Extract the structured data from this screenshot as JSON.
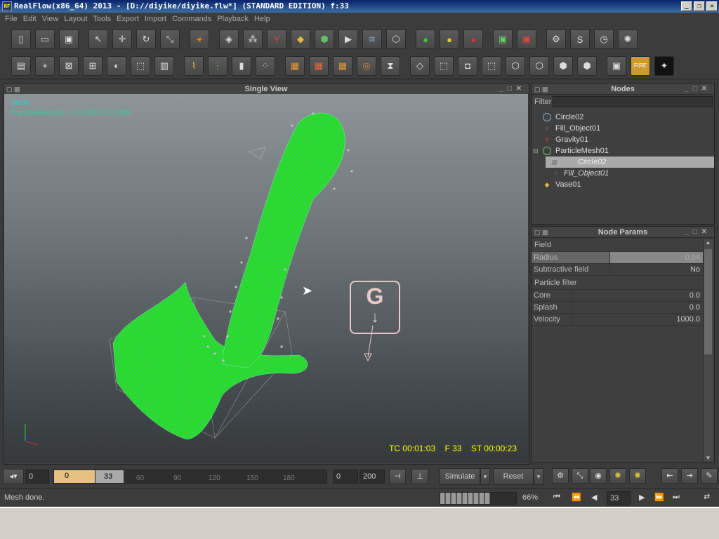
{
  "window": {
    "title": "RealFlow(x86_64) 2013 - [D://diyike/diyike.flw*] (STANDARD EDITION) f:33",
    "icon_text": "RF",
    "minimize": "_",
    "restore": "❐",
    "close": "✕"
  },
  "menu": [
    "File",
    "Edit",
    "View",
    "Layout",
    "Tools",
    "Export",
    "Import",
    "Commands",
    "Playback",
    "Help"
  ],
  "viewport": {
    "title": "Single View",
    "camera": "persp",
    "mesh_info": "ParticleMesh01 - V:3,092 F:17,008",
    "gravity_letter": "G",
    "hud_tc": "TC 00:01:03",
    "hud_f": "F 33",
    "hud_st": "ST 00:00:23"
  },
  "nodes": {
    "title": "Nodes",
    "filter_label": "Filter",
    "items": [
      {
        "label": "Circle02",
        "icon": "circle-emitter-icon",
        "indent": 0
      },
      {
        "label": "Fill_Object01",
        "icon": "fill-object-icon",
        "indent": 0
      },
      {
        "label": "Gravity01",
        "icon": "gravity-icon",
        "indent": 0
      },
      {
        "label": "ParticleMesh01",
        "icon": "particle-mesh-icon",
        "indent": 0
      },
      {
        "label": "Circle02",
        "icon": "circle-emitter-icon",
        "indent": 1,
        "selected": true
      },
      {
        "label": "Fill_Object01",
        "icon": "fill-object-icon",
        "indent": 1
      },
      {
        "label": "Vase01",
        "icon": "vase-object-icon",
        "indent": 0
      }
    ]
  },
  "params": {
    "title": "Node Params",
    "section_field": "Field",
    "radius_label": "Radius",
    "radius_value": "0.04",
    "subtractive_label": "Subtractive field",
    "subtractive_value": "No",
    "section_filter": "Particle filter",
    "core_label": "Core",
    "core_value": "0.0",
    "splash_label": "Splash",
    "splash_value": "0.0",
    "velocity_label": "Velocity",
    "velocity_value": "1000.0"
  },
  "timeline": {
    "start": "0",
    "frame_marker": "0",
    "current": "33",
    "ticks": [
      "60",
      "90",
      "120",
      "150",
      "180"
    ],
    "range_start": "0",
    "range_end": "200",
    "simulate_label": "Simulate",
    "reset_label": "Reset"
  },
  "status": {
    "message": "Mesh done.",
    "progress_percent": 66,
    "progress_label": "66%",
    "frame_field": "33"
  },
  "colors": {
    "mesh_green": "#22dd22",
    "hud_yellow": "#ffff00",
    "camera_cyan": "#33cccc",
    "gravity_pink": "#e8c8c8"
  }
}
